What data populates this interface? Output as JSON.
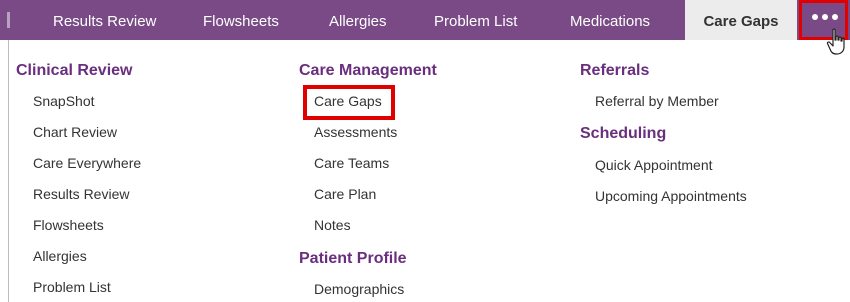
{
  "tabs": [
    {
      "label": "Results Review"
    },
    {
      "label": "Flowsheets"
    },
    {
      "label": "Allergies"
    },
    {
      "label": "Problem List"
    },
    {
      "label": "Medications"
    },
    {
      "label": "Care Gaps",
      "active": true
    }
  ],
  "more_button": {
    "icon": "more-dots-icon"
  },
  "menu": {
    "clinical_review": {
      "header": "Clinical Review",
      "items": [
        "SnapShot",
        "Chart Review",
        "Care Everywhere",
        "Results Review",
        "Flowsheets",
        "Allergies",
        "Problem List"
      ]
    },
    "care_management": {
      "header": "Care Management",
      "items": [
        "Care Gaps",
        "Assessments",
        "Care Teams",
        "Care Plan",
        "Notes"
      ]
    },
    "patient_profile": {
      "header": "Patient Profile",
      "items": [
        "Demographics"
      ]
    },
    "referrals": {
      "header": "Referrals",
      "items": [
        "Referral by Member"
      ]
    },
    "scheduling": {
      "header": "Scheduling",
      "items": [
        "Quick Appointment",
        "Upcoming Appointments"
      ]
    }
  },
  "colors": {
    "tabbar": "#7a4a86",
    "active_tab": "#ececec",
    "header_text": "#6a2e7e",
    "highlight": "#e10000"
  }
}
